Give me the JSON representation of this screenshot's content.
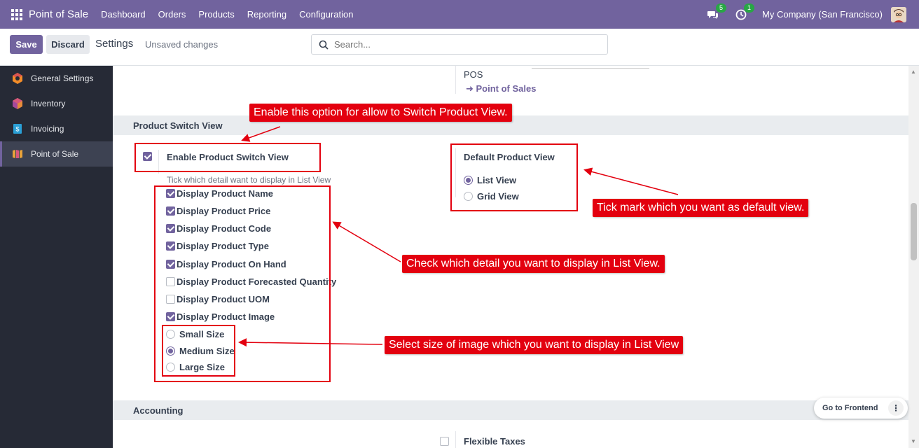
{
  "navbar": {
    "brand": "Point of Sale",
    "menu": [
      "Dashboard",
      "Orders",
      "Products",
      "Reporting",
      "Configuration"
    ],
    "chat_badge": "5",
    "activity_badge": "1",
    "company": "My Company (San Francisco)"
  },
  "control_panel": {
    "save_label": "Save",
    "discard_label": "Discard",
    "title": "Settings",
    "status": "Unsaved changes",
    "search_placeholder": "Search..."
  },
  "sidebar": {
    "items": [
      {
        "label": "General Settings",
        "icon": "general-settings-icon",
        "active": false
      },
      {
        "label": "Inventory",
        "icon": "inventory-icon",
        "active": false
      },
      {
        "label": "Invoicing",
        "icon": "invoicing-icon",
        "active": false
      },
      {
        "label": "Point of Sale",
        "icon": "pos-icon",
        "active": true
      }
    ]
  },
  "top_block": {
    "pos_label": "POS",
    "pos_link": "Point of Sales"
  },
  "product_switch": {
    "header": "Product Switch View",
    "enable_label": "Enable Product Switch View",
    "enable_checked": true,
    "hint": "Tick which detail want to display in List View",
    "details": [
      {
        "label": "Display Product Name",
        "checked": true
      },
      {
        "label": "Display Product Price",
        "checked": true
      },
      {
        "label": "Display Product Code",
        "checked": true
      },
      {
        "label": "Display Product Type",
        "checked": true
      },
      {
        "label": "Display Product On Hand",
        "checked": true
      },
      {
        "label": "Display Product Forecasted Quantity",
        "checked": false
      },
      {
        "label": "Display Product UOM",
        "checked": false
      },
      {
        "label": "Display Product Image",
        "checked": true
      }
    ],
    "image_sizes": [
      {
        "label": "Small Size",
        "selected": false
      },
      {
        "label": "Medium Size",
        "selected": true
      },
      {
        "label": "Large Size",
        "selected": false
      }
    ],
    "default_view_title": "Default Product View",
    "default_views": [
      {
        "label": "List View",
        "selected": true
      },
      {
        "label": "Grid View",
        "selected": false
      }
    ]
  },
  "accounting": {
    "header": "Accounting",
    "flexible_taxes_label": "Flexible Taxes",
    "flexible_taxes_checked": false
  },
  "annotations": {
    "enable_note": "Enable this option for allow to Switch Product View.",
    "default_note": "Tick mark which you want as default view.",
    "details_note": "Check which detail you want to display in List View.",
    "size_note": "Select size of image which you want to display in List View"
  },
  "floating": {
    "go_frontend": "Go to Frontend"
  },
  "colors": {
    "brand": "#71639e",
    "annotation": "#e3000f",
    "sidebar": "#262a36"
  }
}
